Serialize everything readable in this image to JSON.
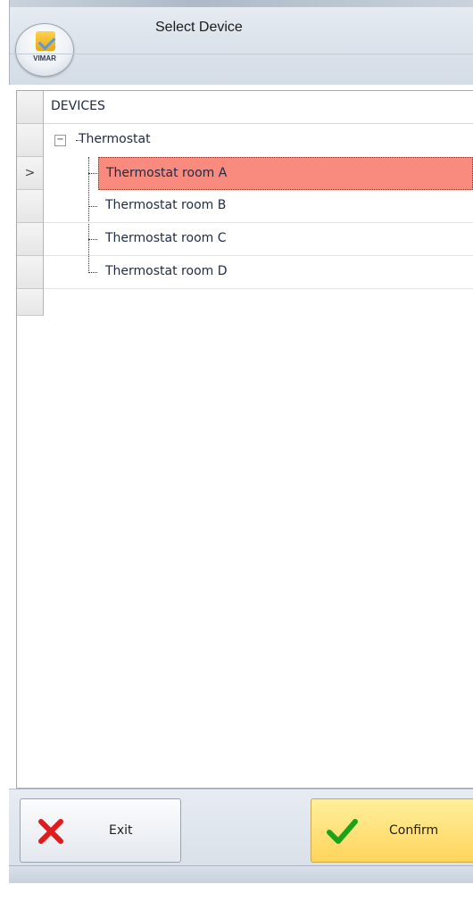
{
  "window": {
    "title": "Select Device",
    "logo_text": "VIMAR"
  },
  "grid": {
    "column_header": "DEVICES",
    "indicator_arrow": ">",
    "parent": {
      "label": "Thermostat",
      "expander_symbol": "−"
    },
    "children": [
      {
        "label": "Thermostat room A",
        "selected": true
      },
      {
        "label": "Thermostat room B",
        "selected": false
      },
      {
        "label": "Thermostat room C",
        "selected": false
      },
      {
        "label": "Thermostat room D",
        "selected": false
      }
    ]
  },
  "buttons": {
    "exit_label": "Exit",
    "confirm_label": "Confirm"
  },
  "colors": {
    "selected_row": "#f98b7e",
    "exit_icon": "#e01b1b",
    "confirm_icon": "#1aa31a"
  },
  "icons": {
    "exit": "x-icon",
    "confirm": "checkmark-icon",
    "app": "vimar-logo-icon"
  }
}
